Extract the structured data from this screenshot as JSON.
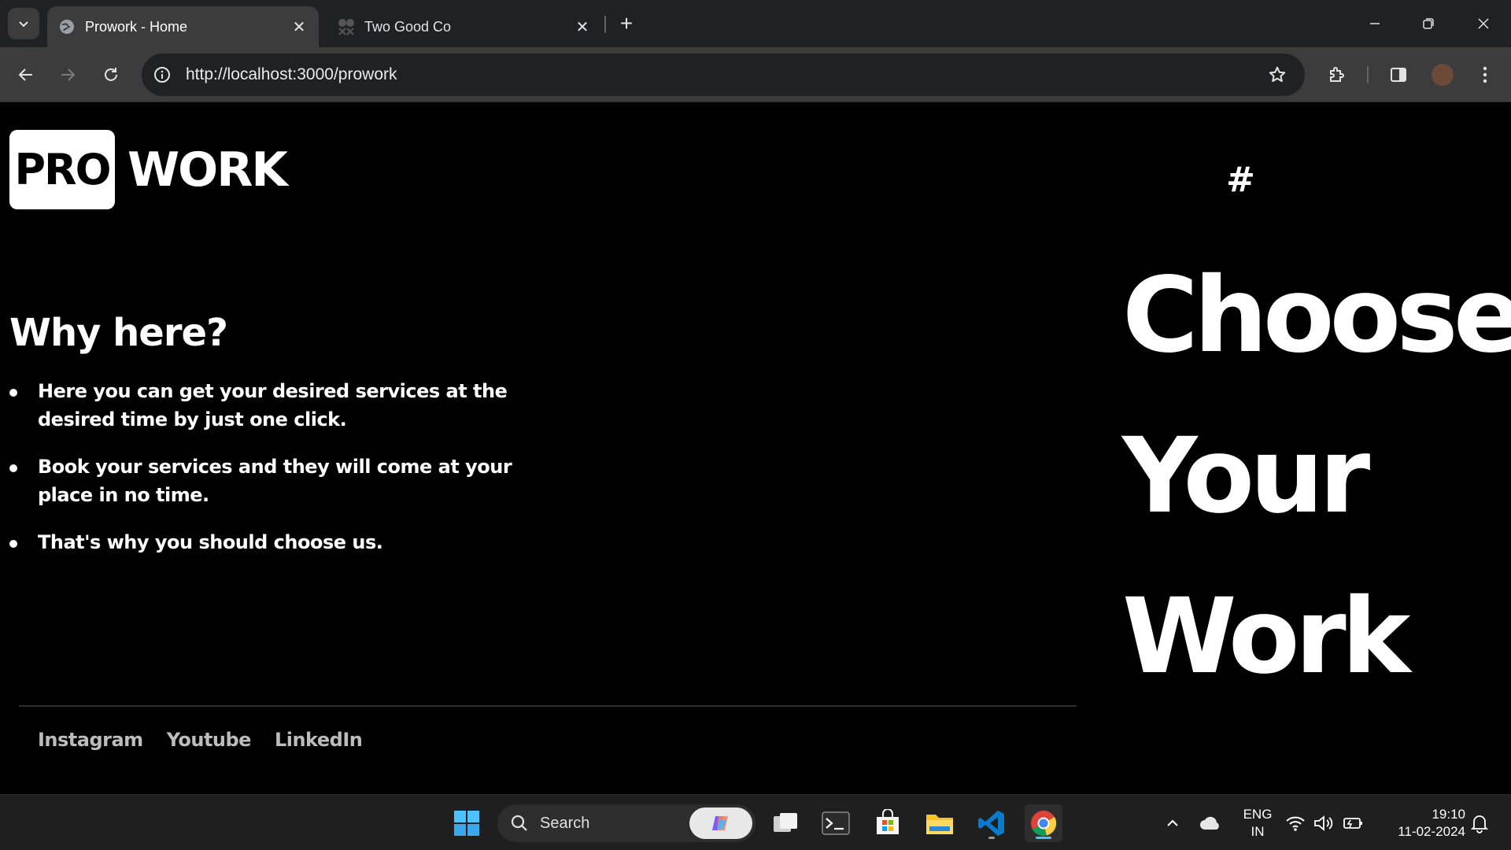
{
  "browser": {
    "tabs": [
      {
        "title": "Prowork - Home",
        "active": true
      },
      {
        "title": "Two Good Co",
        "active": false
      }
    ],
    "url": "http://localhost:3000/prowork"
  },
  "page": {
    "logo": {
      "badge": "PRO",
      "text": "WORK"
    },
    "why": {
      "title": "Why here?",
      "points": [
        "Here you can get your desired services at the desired time by just one click.",
        "Book your services and they will come at your place in no time.",
        "That's why you should choose us."
      ]
    },
    "socials": [
      "Instagram",
      "Youtube",
      "LinkedIn"
    ],
    "hero": {
      "hash": "#",
      "lines": [
        "Choose",
        "Your",
        "Work"
      ]
    }
  },
  "taskbar": {
    "search_placeholder": "Search",
    "lang": {
      "line1": "ENG",
      "line2": "IN"
    },
    "time": "19:10",
    "date": "11-02-2024"
  },
  "colors": {
    "page_bg": "#000000",
    "chrome_dark": "#202124",
    "chrome_mid": "#3c3c3c",
    "taskbar_bg": "#1f1f1f",
    "accent_blue": "#4cc2ff"
  }
}
